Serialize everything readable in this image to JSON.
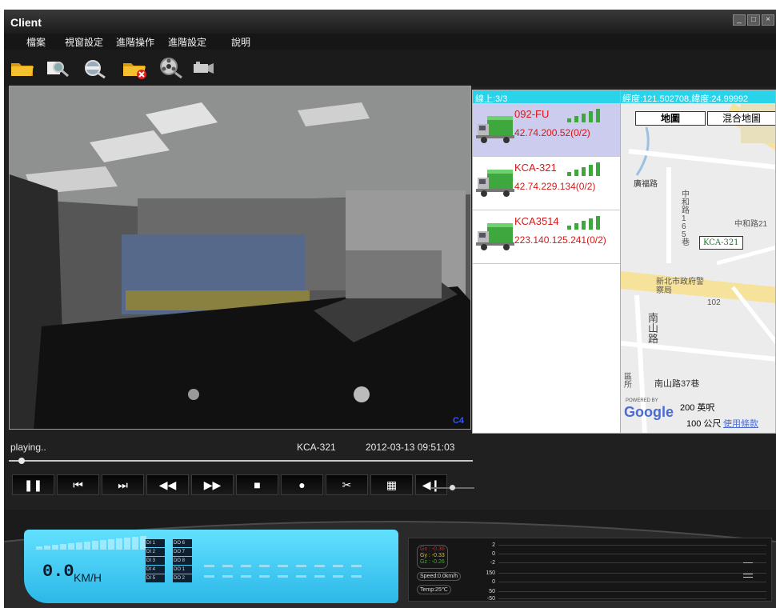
{
  "window": {
    "title": "Client"
  },
  "menu": [
    "檔案",
    "視窗設定",
    "進階操作",
    "進階設定",
    "說明"
  ],
  "toolbar": {
    "tools": [
      "open-folder",
      "search-vehicle",
      "settings-search",
      "close-folder",
      "video-search",
      "camera"
    ]
  },
  "video": {
    "channel": "C4"
  },
  "vehicle_list": {
    "header": "線上:3/3",
    "vehicles": [
      {
        "name": "092-FU",
        "ip": "42.74.200.52(0/2)",
        "selected": true
      },
      {
        "name": "KCA-321",
        "ip": "42.74.229.134(0/2)",
        "selected": false
      },
      {
        "name": "KCA3514",
        "ip": "223.140.125.241(0/2)",
        "selected": false
      }
    ]
  },
  "map": {
    "coords": "經度:121.502708,緯度:24.99992",
    "btn_map": "地圖",
    "btn_hybrid": "混合地圖",
    "marker": "KCA-321",
    "labels": {
      "road1": "廣福路",
      "road2": "中和路1 6 5 巷",
      "road3": "中和路21",
      "poi1": "新北市政府警察局",
      "road4": "102",
      "road5": "南山路",
      "road6": "南山路37巷",
      "district": "區 所"
    },
    "google": "Google",
    "powered_by": "POWERED BY",
    "scale_imperial": "200 英呎",
    "scale_metric": "100 公尺",
    "terms": "使用條款"
  },
  "status": {
    "state": "playing..",
    "vehicle": "KCA-321",
    "timestamp": "2012-03-13 09:51:03"
  },
  "controls": {
    "pause": "❚❚",
    "prev": "⏮",
    "next": "⏭",
    "rewind": "◀◀",
    "forward": "▶▶",
    "stop": "■",
    "record": "●",
    "snapshot": "✂",
    "layout": "▦",
    "volume": "◀❙"
  },
  "dashboard": {
    "speed": "0.0",
    "speed_unit": "KM/H",
    "di_labels": [
      "DI 1",
      "DI 2",
      "DI 3",
      "DI 4",
      "DI 5",
      "DO 6",
      "DO 7",
      "DO 8",
      "DO 1",
      "DO 2"
    ],
    "sensors": {
      "gx": "Gx : -0.36",
      "gy": "Gy : -0.33",
      "gz": "Gz : -0.26",
      "speed": "Speed:0.0km/h",
      "temp": "Temp:25℃"
    },
    "graph_ticks": [
      "2",
      "0",
      "-2",
      "150",
      "0",
      "50",
      "-50"
    ]
  },
  "colors": {
    "accent": "#29d3ea",
    "vehicle_text": "#d81818",
    "lcd": "#4fd3f5",
    "gx": "#d82020",
    "gy": "#e6c000",
    "gz": "#20c020"
  }
}
